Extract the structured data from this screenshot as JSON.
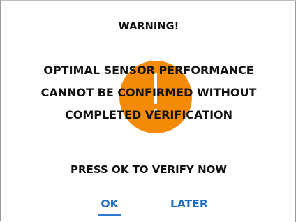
{
  "dialog": {
    "title": "WARNING!",
    "message_lines": [
      "OPTIMAL SENSOR PERFORMANCE",
      "CANNOT BE CONFIRMED WITHOUT",
      "COMPLETED VERIFICATION"
    ],
    "prompt": "PRESS OK TO VERIFY NOW",
    "buttons": {
      "ok": "OK",
      "later": "LATER"
    },
    "selected_button": "ok",
    "icon": "exclamation-circle-icon"
  },
  "colors": {
    "icon_orange": "#f58a07",
    "button_blue": "#1d6ec2",
    "text": "#111111",
    "background": "#ffffff"
  }
}
